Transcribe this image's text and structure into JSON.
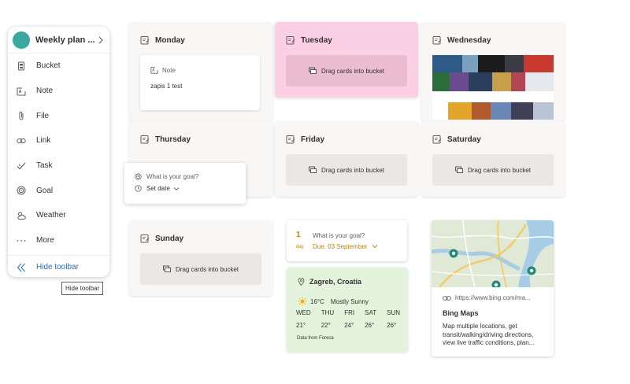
{
  "toolbar": {
    "plan_title": "Weekly plan ...",
    "items": [
      {
        "label": "Bucket",
        "icon": "bucket-icon"
      },
      {
        "label": "Note",
        "icon": "note-icon"
      },
      {
        "label": "File",
        "icon": "paperclip-icon"
      },
      {
        "label": "Link",
        "icon": "link-icon"
      },
      {
        "label": "Task",
        "icon": "checkmark-icon"
      },
      {
        "label": "Goal",
        "icon": "target-icon"
      },
      {
        "label": "Weather",
        "icon": "cloud-sun-icon"
      },
      {
        "label": "More",
        "icon": "ellipsis-icon"
      }
    ],
    "hide_label": "Hide toolbar",
    "tooltip": "Hide toolbar"
  },
  "days": {
    "monday": {
      "title": "Monday",
      "note_label": "Note",
      "note_text": "zapis 1 test"
    },
    "tuesday": {
      "title": "Tuesday",
      "drop": "Drag cards into bucket"
    },
    "wednesday": {
      "title": "Wednesday"
    },
    "thursday": {
      "title": "Thursday"
    },
    "friday": {
      "title": "Friday",
      "drop": "Drag cards into bucket"
    },
    "saturday": {
      "title": "Saturday",
      "drop": "Drag cards into bucket"
    },
    "sunday": {
      "title": "Sunday",
      "drop": "Drag cards into bucket"
    }
  },
  "goal_popover": {
    "question": "What is your goal?",
    "set_date": "Set date"
  },
  "goal_card": {
    "number": "1",
    "unit": "day",
    "question": "What is your goal?",
    "due": "Due: 03 September"
  },
  "weather": {
    "location": "Zagreb, Croatia",
    "current_temp": "16°C",
    "condition": "Mostly Sunny",
    "forecast": [
      {
        "day": "WED",
        "temp": "21°"
      },
      {
        "day": "THU",
        "temp": "22°"
      },
      {
        "day": "FRI",
        "temp": "24°"
      },
      {
        "day": "SAT",
        "temp": "26°"
      },
      {
        "day": "SUN",
        "temp": "26°"
      }
    ],
    "source": "Data from Foreca"
  },
  "bing": {
    "url": "https://www.bing.com/ma...",
    "title": "Bing Maps",
    "description": "Map multiple locations, get transit/walking/driving directions, view live traffic conditions, plan..."
  },
  "colors": {
    "accent_blue": "#2b6ac1",
    "tuesday_pink": "#fbd0e4",
    "weather_green": "#e4f3dc",
    "goal_gold": "#c08400",
    "avatar_teal": "#38a8a0"
  }
}
